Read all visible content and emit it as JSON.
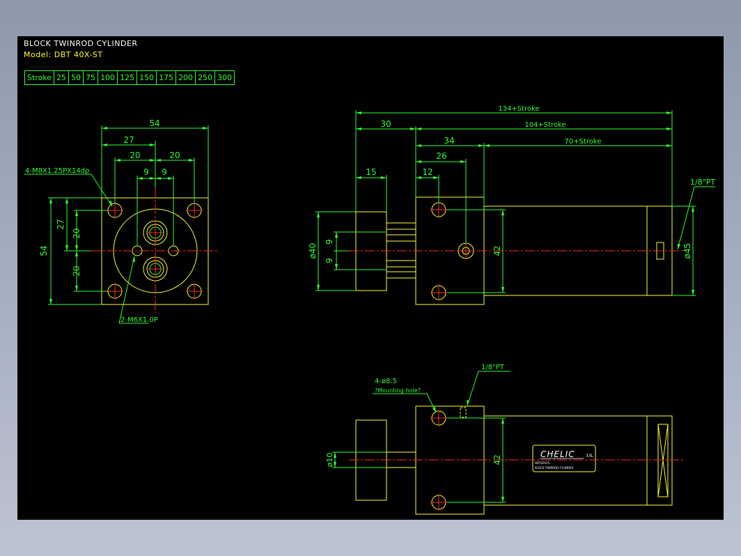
{
  "title": {
    "line1": "BLOCK TWINROD CYLINDER",
    "line2": "Model: DBT 40X-ST"
  },
  "stroke_table": [
    "Stroke",
    "25",
    "50",
    "75",
    "100",
    "125",
    "150",
    "175",
    "200",
    "250",
    "300"
  ],
  "front_view": {
    "dims": {
      "overall": "54",
      "half": "27",
      "spacing": "20",
      "spacing2": "20",
      "inner_a": "9",
      "inner_b": "9",
      "height": "54",
      "height_half": "27",
      "v20a": "20",
      "v20b": "20"
    },
    "callouts": {
      "tap_holes": "4-M8X1.25PX14dp",
      "rod_threads": "2-M6X1.0P"
    }
  },
  "side_view": {
    "dims": {
      "total": "134+Stroke",
      "front": "30",
      "body_total": "104+Stroke",
      "block": "34",
      "tube": "70+Stroke",
      "plate": "15",
      "offset_a": "12",
      "offset_b": "26",
      "rod_dia": "ø40",
      "rod_a": "9",
      "rod_b": "9",
      "height": "42",
      "tube_dia": "ø45"
    },
    "port": "1/8\"PT"
  },
  "bottom_view": {
    "dims": {
      "rod_dia": "ø10",
      "height": "42"
    },
    "port": "1/8\"PT",
    "mount_label": "4-ø8.5",
    "mount_note": "?Mounting-hole?",
    "brand": "CHELIC",
    "brand_suffix": "33L",
    "nameplate_line1": "DBT40X25",
    "nameplate_line2": "BLOCK TWINROD CYLINDER"
  },
  "colors": {
    "background": "#000000",
    "outline": "#ffff33",
    "dimension": "#33ff33",
    "centerline": "#ff2a2a",
    "text": "#ffffff"
  }
}
